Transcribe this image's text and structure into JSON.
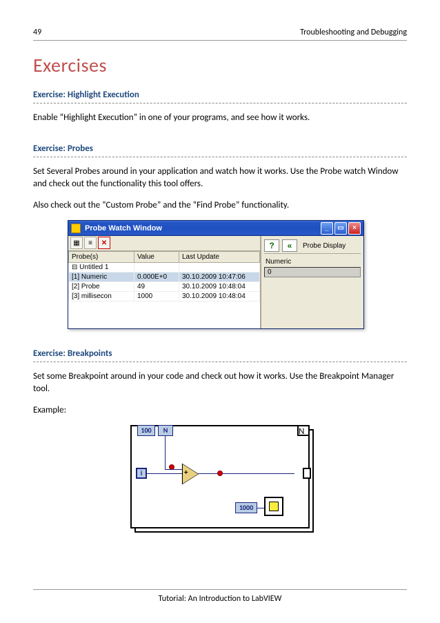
{
  "header": {
    "page": "49",
    "chapter": "Troubleshooting and Debugging"
  },
  "title": "Exercises",
  "ex1": {
    "heading": "Exercise: Highlight Execution",
    "body": "Enable “Highlight Execution” in one of your programs, and see how it works."
  },
  "ex2": {
    "heading": "Exercise: Probes",
    "body1": "Set Several Probes around in your application and watch how it works. Use the Probe watch Window and check out the functionality this tool offers.",
    "body2": "Also check out the “Custom Probe” and the “Find Probe” functionality."
  },
  "probe_window": {
    "title": "Probe Watch Window",
    "columns": {
      "c1": "Probe(s)",
      "c2": "Value",
      "c3": "Last Update"
    },
    "root": "Untitled 1",
    "rows": [
      {
        "name": "[1] Numeric",
        "value": "0.000E+0",
        "time": "30.10.2009 10:47:06"
      },
      {
        "name": "[2] Probe",
        "value": "49",
        "time": "30.10.2009 10:48:04"
      },
      {
        "name": "[3] millisecon",
        "value": "1000",
        "time": "30.10.2009 10:48:04"
      }
    ],
    "right": {
      "section": "Probe Display",
      "label": "Numeric",
      "value": "0"
    }
  },
  "ex3": {
    "heading": "Exercise: Breakpoints",
    "body": "Set some Breakpoint around in your code and check out how it works. Use the Breakpoint Manager tool.",
    "example": "Example:"
  },
  "diagram": {
    "hundred": "100",
    "n": "N",
    "i": "i",
    "thousand": "1000"
  },
  "footer": "Tutorial: An Introduction to LabVIEW"
}
